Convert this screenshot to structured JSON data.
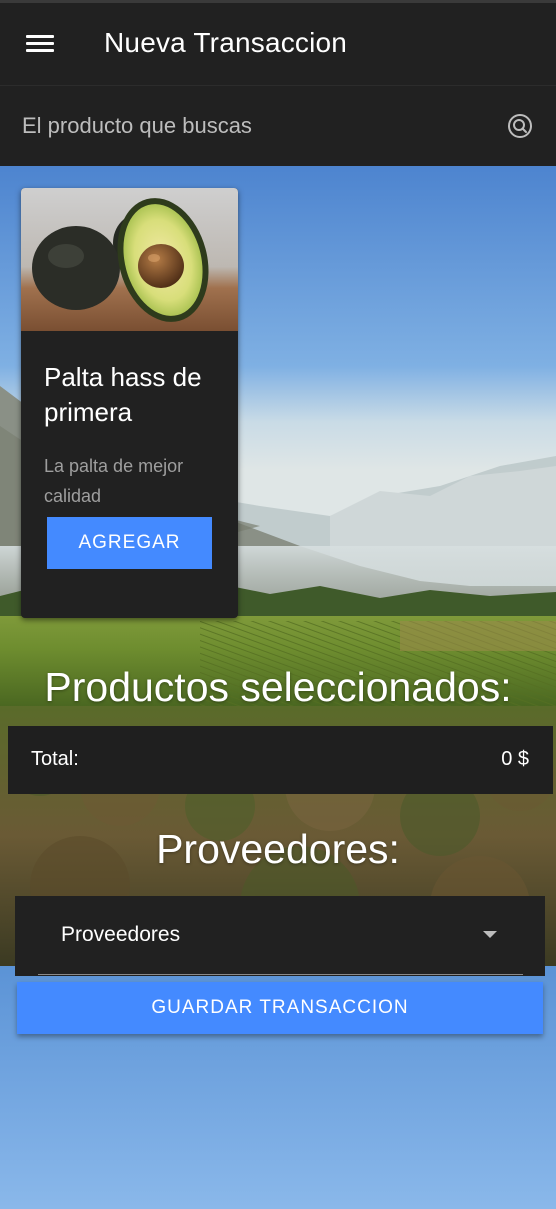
{
  "appbar": {
    "menu_icon": "hamburger-menu-icon",
    "title": "Nueva Transaccion"
  },
  "search": {
    "placeholder": "El producto que buscas",
    "icon": "search-icon"
  },
  "products": [
    {
      "image": "avocado-photo",
      "title": "Palta hass de primera",
      "description": "La palta de mejor calidad",
      "add_label": "AGREGAR"
    }
  ],
  "selected": {
    "heading": "Productos seleccionados:",
    "total_label": "Total:",
    "total_value": "0 $"
  },
  "providers": {
    "heading": "Proveedores:",
    "select_value": "Proveedores",
    "arrow_icon": "dropdown-arrow-icon"
  },
  "actions": {
    "save_label": "GUARDAR TRANSACCION"
  },
  "colors": {
    "appbar": "#212121",
    "accent_button": "#448aff",
    "text": "#ffffff",
    "muted_text": "#9e9e9e"
  }
}
